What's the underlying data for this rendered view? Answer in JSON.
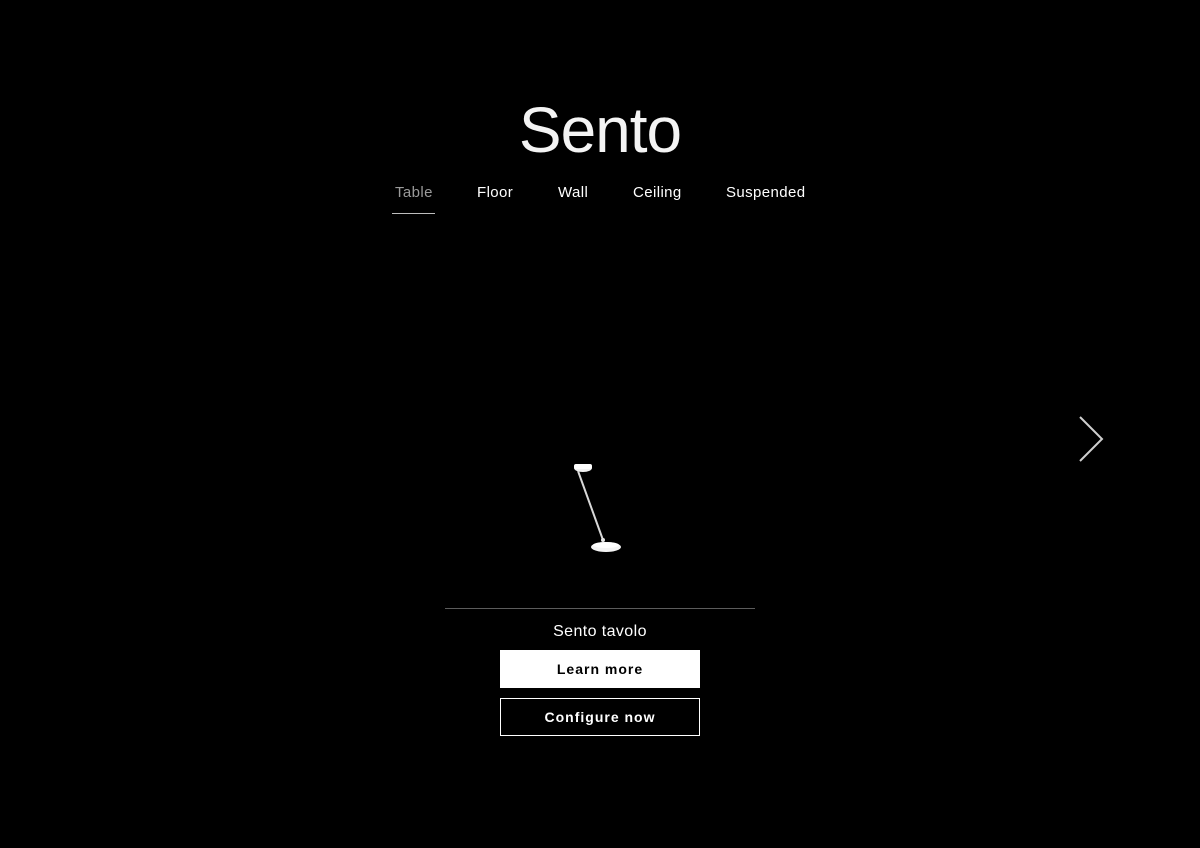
{
  "header": {
    "title": "Sento"
  },
  "tabs": [
    {
      "label": "Table",
      "active": true
    },
    {
      "label": "Floor",
      "active": false
    },
    {
      "label": "Wall",
      "active": false
    },
    {
      "label": "Ceiling",
      "active": false
    },
    {
      "label": "Suspended",
      "active": false
    }
  ],
  "carousel": {
    "next_icon": "chevron-right-icon"
  },
  "product": {
    "name": "Sento tavolo",
    "image_icon": "table-lamp-icon",
    "learn_more_label": "Learn more",
    "configure_label": "Configure now"
  },
  "colors": {
    "background": "#000000",
    "text": "#ffffff",
    "active_tab": "#9a9a9a",
    "divider": "#5c5c5c"
  }
}
